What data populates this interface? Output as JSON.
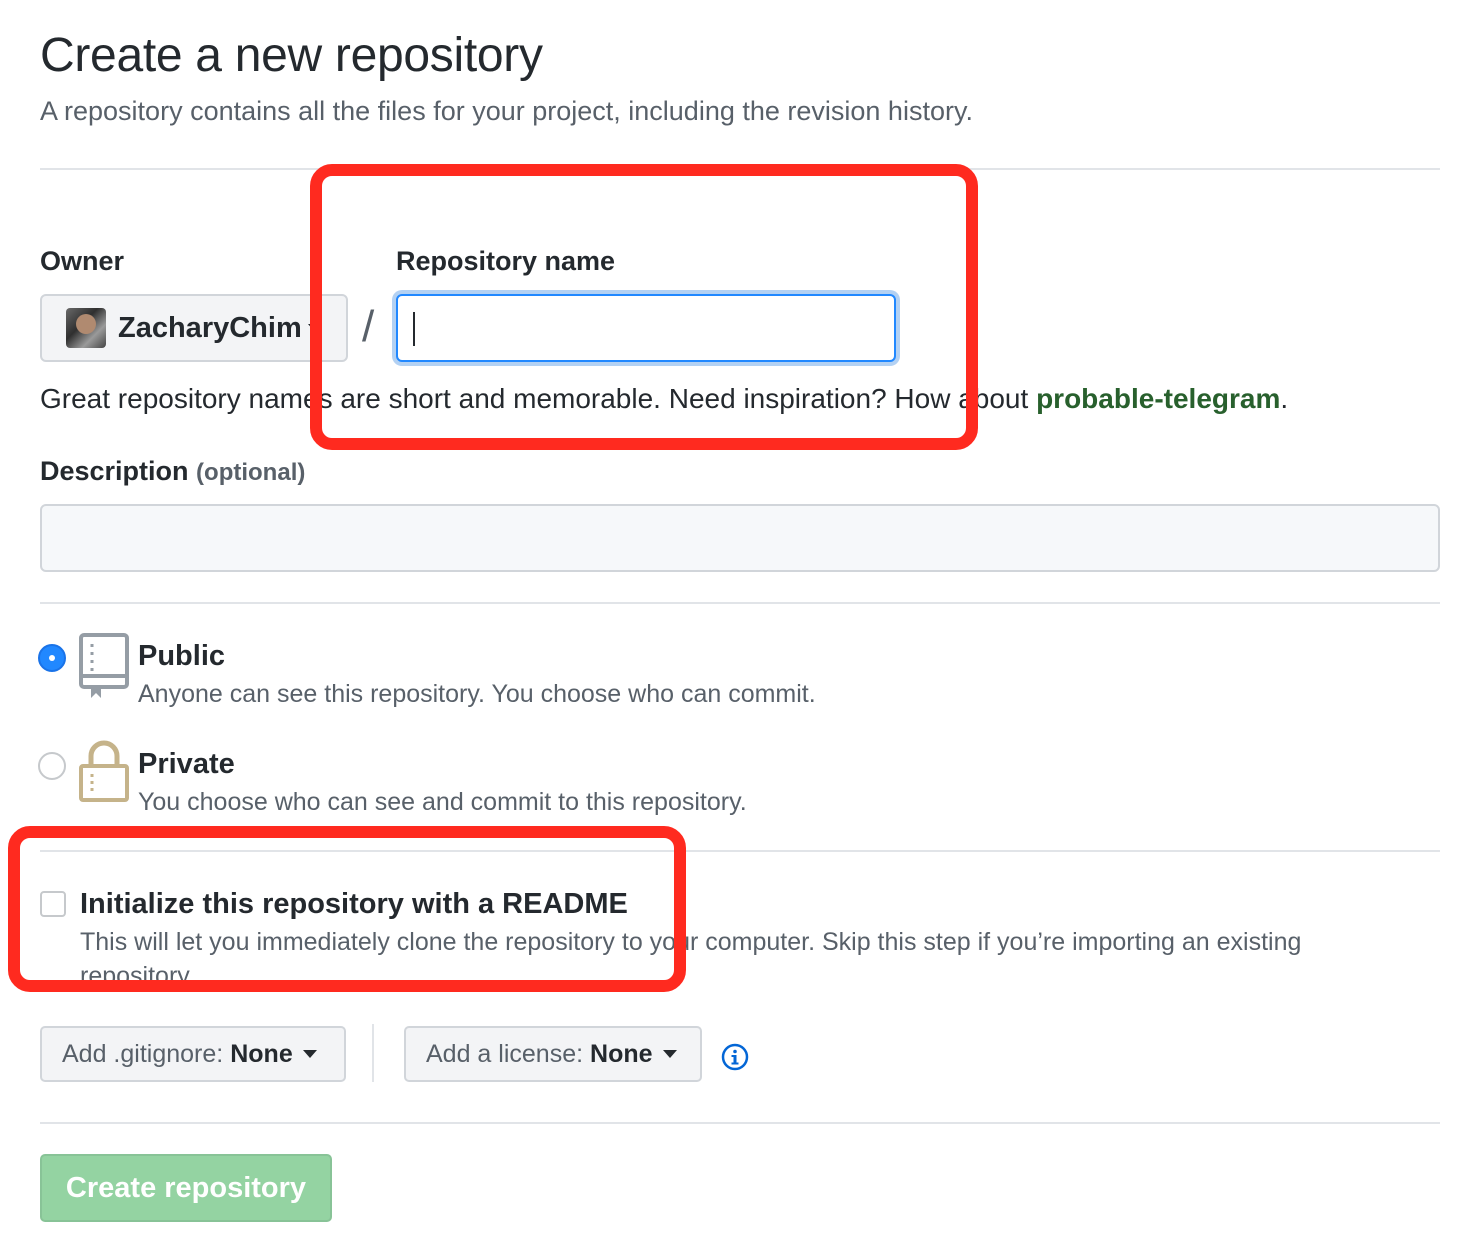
{
  "header": {
    "title": "Create a new repository",
    "subtitle": "A repository contains all the files for your project, including the revision history."
  },
  "owner": {
    "label": "Owner",
    "selected": "ZacharyChim",
    "icon": "avatar"
  },
  "separator": "/",
  "repository_name": {
    "label": "Repository name",
    "value": "",
    "placeholder": ""
  },
  "name_hint": {
    "text": "Great repository names are short and memorable. Need inspiration? How about ",
    "suggestion": "probable-telegram",
    "suffix": "."
  },
  "description": {
    "label": "Description",
    "optional": "(optional)",
    "value": ""
  },
  "visibility": {
    "public": {
      "label": "Public",
      "description": "Anyone can see this repository. You choose who can commit.",
      "selected": true,
      "icon": "repo-icon"
    },
    "private": {
      "label": "Private",
      "description": "You choose who can see and commit to this repository.",
      "selected": false,
      "icon": "lock-icon"
    }
  },
  "readme": {
    "label": "Initialize this repository with a README",
    "description": "This will let you immediately clone the repository to your computer. Skip this step if you’re importing an existing",
    "description_overflow": "repository.",
    "checked": false
  },
  "gitignore": {
    "label": "Add .gitignore:",
    "value": "None"
  },
  "license": {
    "label": "Add a license:",
    "value": "None"
  },
  "create_button": {
    "label": "Create repository",
    "enabled": false
  },
  "colors": {
    "annotation_red": "#ff2a1f",
    "focus_blue": "#2188ff",
    "link_green": "#28602d",
    "button_green_disabled": "#94d3a2"
  }
}
